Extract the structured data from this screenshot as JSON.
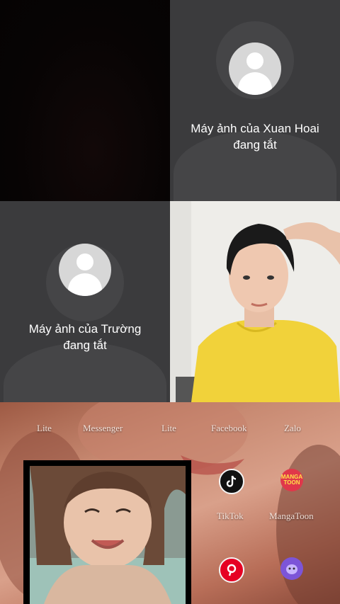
{
  "participants": [
    {
      "id": "remote-1",
      "camera": "on"
    },
    {
      "id": "xuan-hoai",
      "label_line1": "Máy ảnh của Xuan Hoai",
      "label_line2": "đang tắt"
    },
    {
      "id": "truong",
      "label_line1": "Máy ảnh của Trường",
      "label_line2": "đang tắt"
    },
    {
      "id": "remote-4",
      "camera": "on"
    }
  ],
  "home_screen": {
    "top_labels": [
      "Lite",
      "Messenger",
      "Lite",
      "Facebook",
      "Zalo"
    ],
    "apps": [
      {
        "name": "TikTok",
        "icon": "tiktok-icon",
        "color": "#111111"
      },
      {
        "name": "MangaToon",
        "icon": "mangatoon-icon",
        "color": "#e0384a",
        "badge": "MANGA\nTOON"
      },
      {
        "name": "",
        "icon": "pinterest-icon",
        "color": "#e60023"
      },
      {
        "name": "",
        "icon": "purple-app-icon",
        "color": "#7c55d8"
      }
    ]
  },
  "colors": {
    "tile_bg": "#3b3b3d",
    "avatar_bg": "#d7d7d7"
  }
}
